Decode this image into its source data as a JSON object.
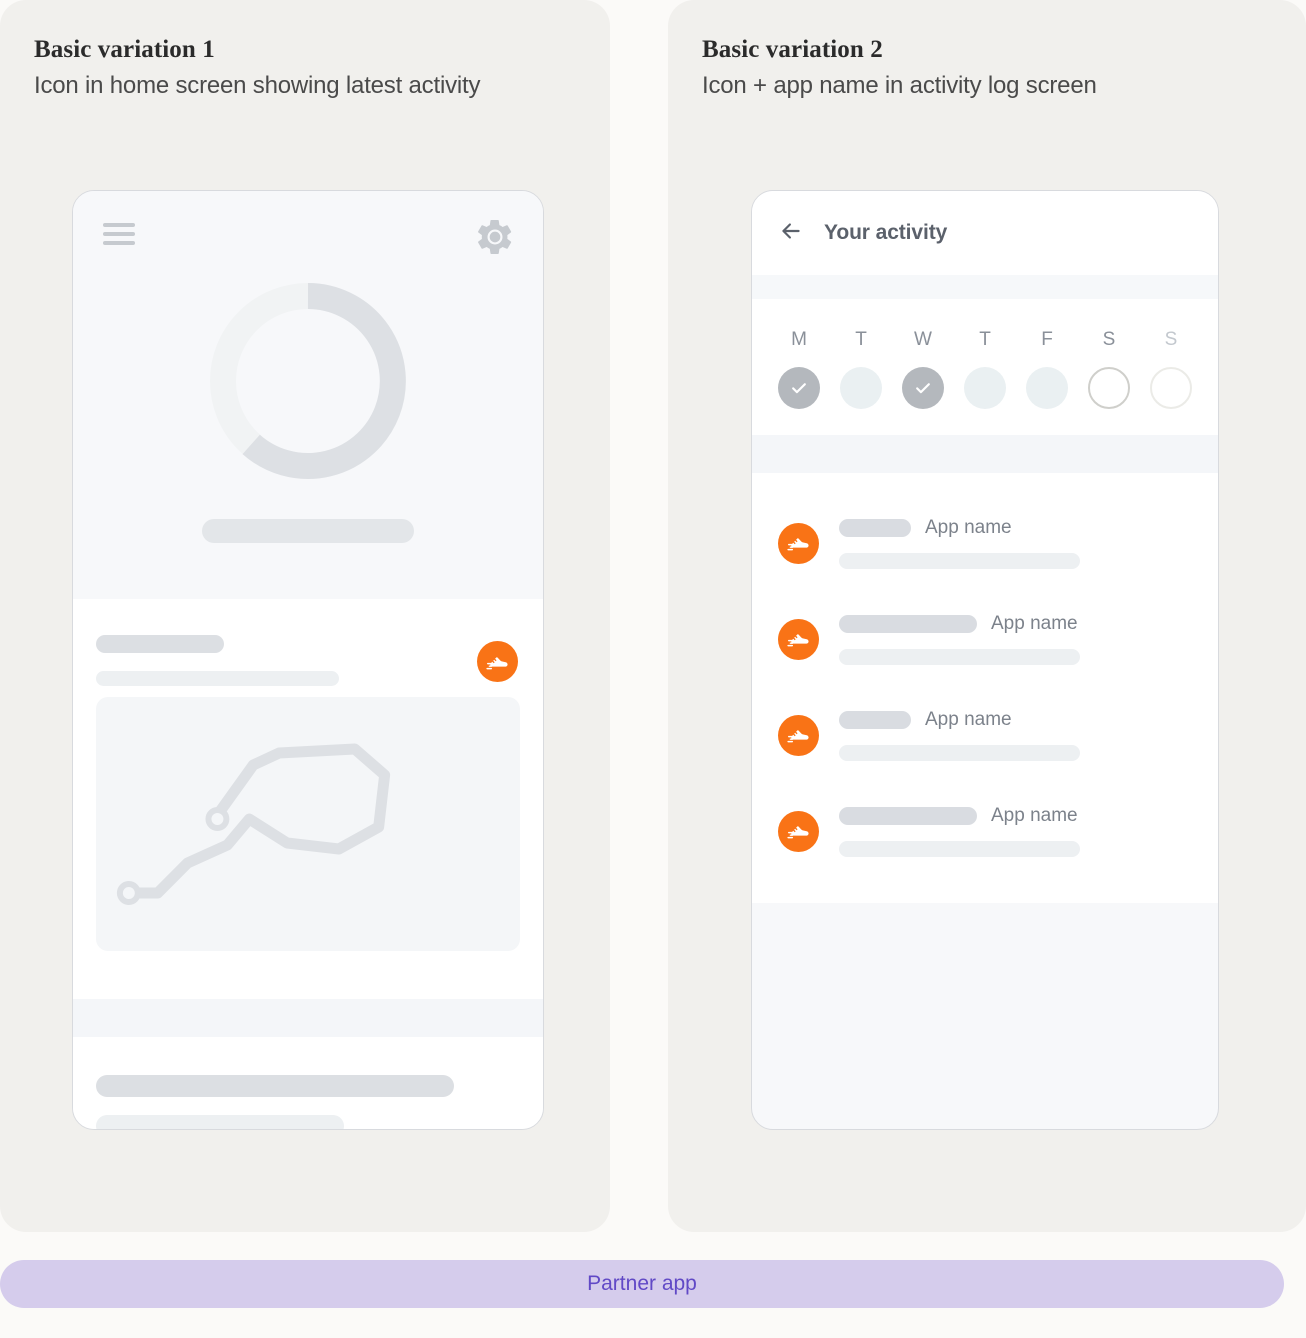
{
  "page": {
    "background": "#FBFAF8",
    "accent_orange": "#F97316",
    "footer_bg": "#D5CCEC",
    "footer_text_color": "#6149C6"
  },
  "panels": [
    {
      "title": "Basic variation 1",
      "subtitle": "Icon in home screen showing latest activity",
      "phone": {
        "menu_icon": "hamburger-menu-icon",
        "settings_icon": "gear-icon",
        "progress_ring": {
          "track_color": "#F1F3F4",
          "value_color": "#DDE0E4",
          "percent": 72
        },
        "app_icon": "running-shoe-icon",
        "map_route_icon": "route-path-icon"
      }
    },
    {
      "title": "Basic variation 2",
      "subtitle": "Icon + app name in activity log screen",
      "phone": {
        "back_icon": "back-arrow-icon",
        "header_title": "Your activity",
        "week": {
          "labels": [
            "M",
            "T",
            "W",
            "T",
            "F",
            "S",
            "S"
          ],
          "states": [
            "done",
            "light",
            "done",
            "light",
            "light",
            "ring",
            "ring-faint"
          ]
        },
        "log_rows": [
          {
            "icon": "running-shoe-icon",
            "pill_width": 72,
            "app_name": "App name",
            "sub_width": 241
          },
          {
            "icon": "running-shoe-icon",
            "pill_width": 138,
            "app_name": "App name",
            "sub_width": 241
          },
          {
            "icon": "running-shoe-icon",
            "pill_width": 72,
            "app_name": "App name",
            "sub_width": 241
          },
          {
            "icon": "running-shoe-icon",
            "pill_width": 138,
            "app_name": "App name",
            "sub_width": 241
          }
        ]
      }
    }
  ],
  "footer": {
    "label": "Partner app"
  }
}
